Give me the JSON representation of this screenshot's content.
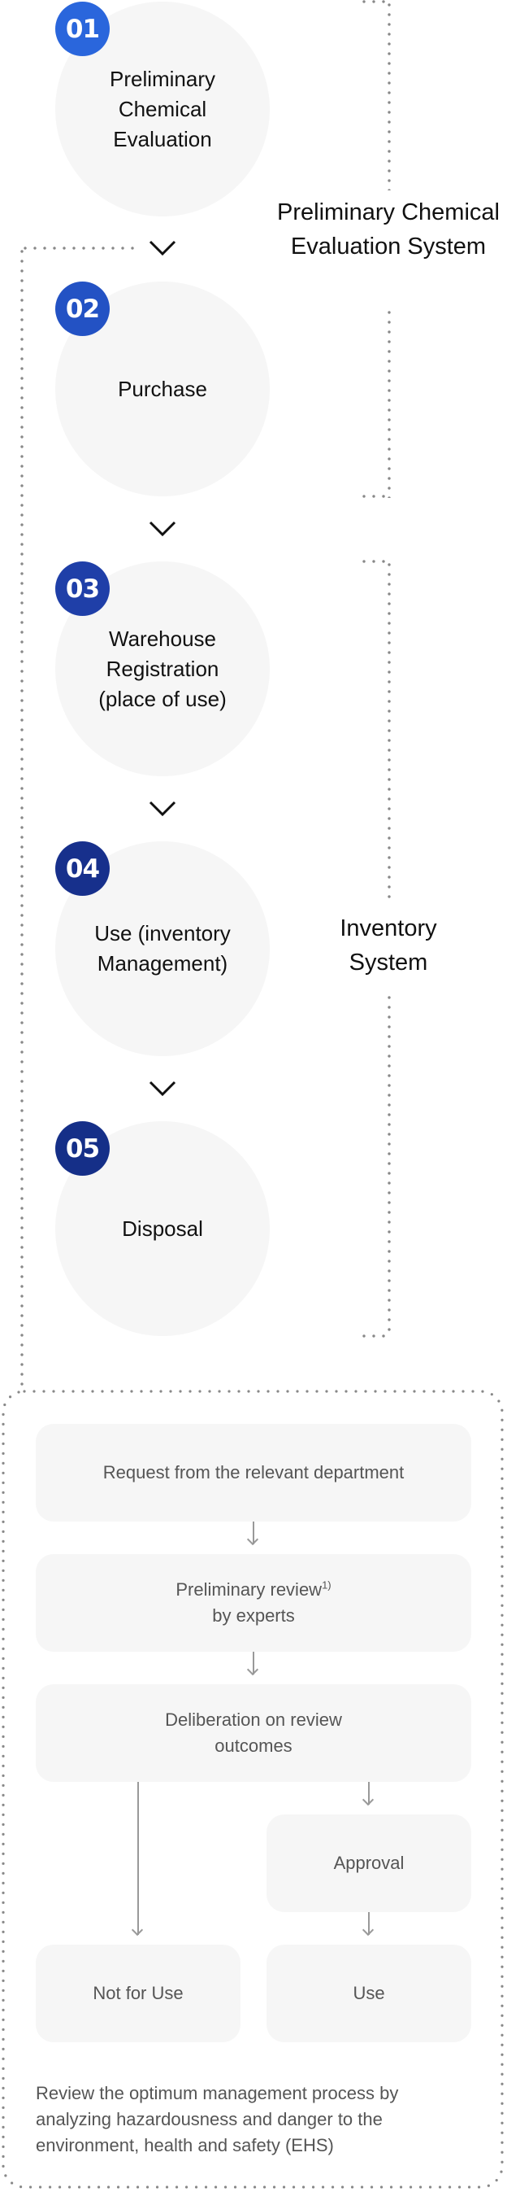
{
  "steps": [
    {
      "number": "01",
      "label": "Preliminary Chemical Evaluation",
      "badge_color": "#2a66dc"
    },
    {
      "number": "02",
      "label": "Purchase",
      "badge_color": "#2352c4"
    },
    {
      "number": "03",
      "label": "Warehouse Registration (place of use)",
      "badge_color": "#1f3fa8"
    },
    {
      "number": "04",
      "label": "Use (inventory Management)",
      "badge_color": "#17308c"
    },
    {
      "number": "05",
      "label": "Disposal",
      "badge_color": "#152f88"
    }
  ],
  "systems": {
    "preliminary": "Preliminary Chemical Evaluation System",
    "inventory": "Inventory System"
  },
  "process": {
    "request": "Request from the relevant department",
    "review": "Preliminary review",
    "review_sup": "1)",
    "review_line2": "by experts",
    "deliberation": "Deliberation on review outcomes",
    "approval": "Approval",
    "not_for_use": "Not for Use",
    "use": "Use"
  },
  "note": "Review the optimum management process by analyzing hazardousness and danger to the environment, health and safety (EHS)"
}
